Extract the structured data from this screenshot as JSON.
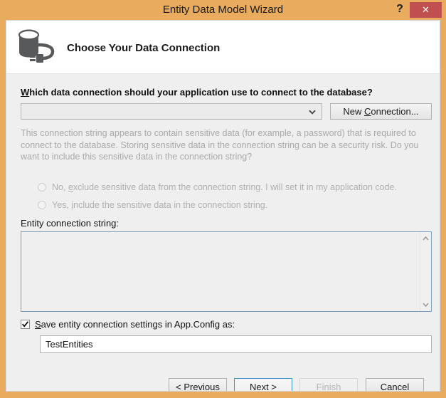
{
  "window": {
    "title": "Entity Data Model Wizard",
    "help_label": "?",
    "close_label": "✕",
    "frame_color": "#e9ab5d",
    "close_color": "#c04f4f"
  },
  "header": {
    "title": "Choose Your Data Connection",
    "icon": "database-connection-icon"
  },
  "form": {
    "question_label": "Which data connection should your application use to connect to the database?",
    "question_accel": "W",
    "connection_combo_value": "",
    "connection_combo_placeholder": "",
    "new_connection_label": "New Connection...",
    "new_connection_accel": "C",
    "sensitive_info_text": "This connection string appears to contain sensitive data (for example, a password) that is required to connect to the database. Storing sensitive data in the connection string can be a security risk. Do you want to include this sensitive data in the connection string?",
    "radios": [
      {
        "label": "No, exclude sensitive data from the connection string. I will set it in my application code.",
        "accel": "e",
        "checked": false,
        "disabled": true
      },
      {
        "label": "Yes, include the sensitive data in the connection string.",
        "accel": "i",
        "checked": false,
        "disabled": true
      }
    ],
    "entity_connection_string_label": "Entity connection string:",
    "entity_connection_string_value": "",
    "save_checkbox_label": "Save entity connection settings in App.Config as:",
    "save_checkbox_accel": "S",
    "save_checkbox_checked": true,
    "app_config_name_value": "TestEntities"
  },
  "footer": {
    "buttons": [
      {
        "label": "< Previous",
        "accel": "P",
        "state": "enabled"
      },
      {
        "label": "Next >",
        "accel": "N",
        "state": "default"
      },
      {
        "label": "Finish",
        "accel": "F",
        "state": "disabled"
      },
      {
        "label": "Cancel",
        "accel": "",
        "state": "enabled"
      }
    ]
  }
}
